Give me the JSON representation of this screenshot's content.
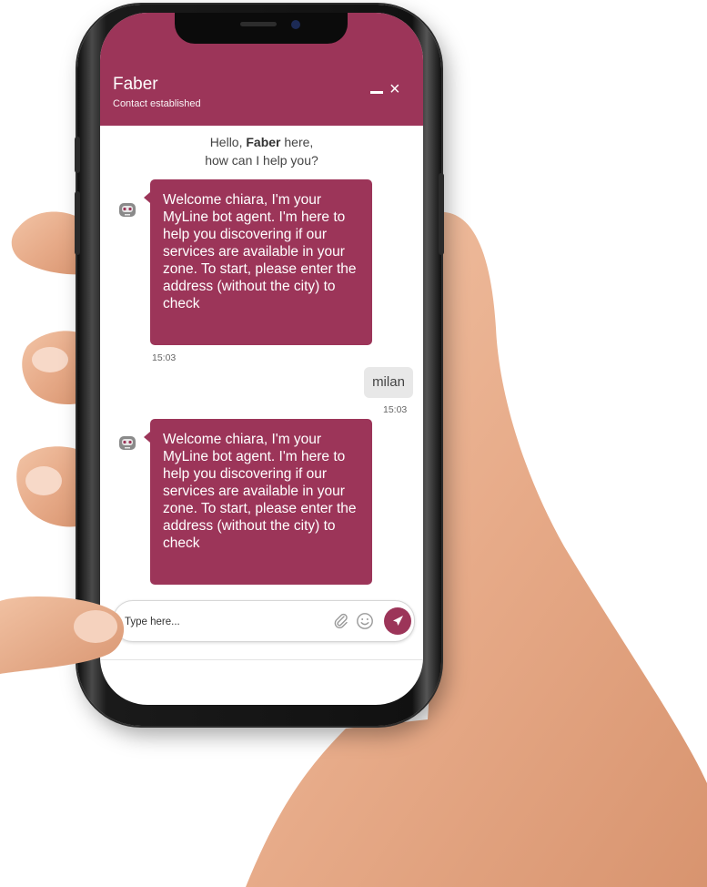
{
  "colors": {
    "brand": "#9c3559",
    "user_bubble": "#e8e8e8"
  },
  "header": {
    "title": "Faber",
    "subtitle": "Contact established",
    "minimize_icon": "minimize-icon",
    "close_label": "×"
  },
  "greeting": {
    "line1_prefix": "Hello, ",
    "line1_name": "Faber",
    "line1_suffix": " here,",
    "line2": "how can I help you?"
  },
  "messages": [
    {
      "sender": "bot",
      "text": "Welcome chiara, I'm your MyLine bot agent. I'm here to help you discovering if our services are available in your zone. To start, please enter the address (without the city) to check",
      "time": "15:03"
    },
    {
      "sender": "user",
      "text": "milan",
      "time": "15:03"
    },
    {
      "sender": "bot",
      "text": "Welcome chiara, I'm your MyLine bot agent. I'm here to help you discovering if our services are available in your zone. To start, please enter the address (without the city) to check"
    }
  ],
  "composer": {
    "placeholder": "Type here...",
    "value": "",
    "icons": [
      "paperclip-icon",
      "emoji-icon",
      "send-icon"
    ]
  }
}
